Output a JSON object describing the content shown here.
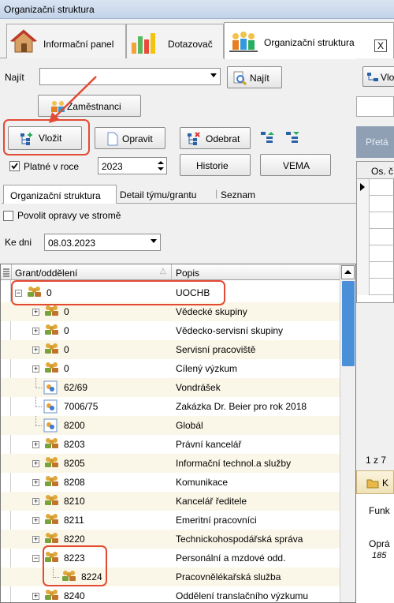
{
  "window": {
    "title": "Organizační struktura"
  },
  "tabs": [
    {
      "label": "Informační panel"
    },
    {
      "label": "Dotazovač"
    },
    {
      "label": "Organizační struktura"
    }
  ],
  "tab_close": "X",
  "search": {
    "label": "Najít",
    "value": "",
    "button": "Najít"
  },
  "buttons": {
    "employees": "Zaměstnanci",
    "insert": "Vložit",
    "edit": "Opravit",
    "remove": "Odebrat",
    "history": "Historie",
    "vema": "VEMA"
  },
  "valid_in_year": {
    "label": "Platné v roce",
    "checked": true,
    "value": "2023"
  },
  "subtabs": [
    "Organizační struktura",
    "Detail týmu/grantu",
    "Seznam"
  ],
  "allow_edit": {
    "label": "Povolit opravy ve stromě",
    "checked": false
  },
  "date": {
    "label": "Ke dni",
    "value": "08.03.2023"
  },
  "grid": {
    "col1": "Grant/oddělení",
    "col2": "Popis",
    "rows": [
      {
        "code": "0",
        "desc": "UOCHB",
        "icon": "group-icon",
        "expanded": true
      },
      {
        "code": "0",
        "desc": "Vědecké skupiny",
        "icon": "group-icon"
      },
      {
        "code": "0",
        "desc": "Vědecko-servisní skupiny",
        "icon": "group-icon"
      },
      {
        "code": "0",
        "desc": "Servisní pracoviště",
        "icon": "group-icon"
      },
      {
        "code": "0",
        "desc": "Cílený výzkum",
        "icon": "group-icon"
      },
      {
        "code": "62/69",
        "desc": "Vondrášek",
        "icon": "grant-icon"
      },
      {
        "code": "7006/75",
        "desc": "Zakázka Dr. Beier pro rok 2018",
        "icon": "grant-icon"
      },
      {
        "code": "8200",
        "desc": "Globál",
        "icon": "grant-icon"
      },
      {
        "code": "8203",
        "desc": "Právní kancelář",
        "icon": "group-icon"
      },
      {
        "code": "8205",
        "desc": "Informační technol.a služby",
        "icon": "group-icon"
      },
      {
        "code": "8208",
        "desc": "Komunikace",
        "icon": "group-icon"
      },
      {
        "code": "8210",
        "desc": "Kancelář ředitele",
        "icon": "group-icon"
      },
      {
        "code": "8211",
        "desc": "Emeritní pracovníci",
        "icon": "group-icon"
      },
      {
        "code": "8220",
        "desc": "Technickohospodářská správa",
        "icon": "group-icon"
      },
      {
        "code": "8223",
        "desc": "Personální a mzdové odd.",
        "icon": "group-icon",
        "expanded": true
      },
      {
        "code": "8224",
        "desc": "Pracovnělékařská služba",
        "icon": "group-icon"
      },
      {
        "code": "8240",
        "desc": "Oddělení translačního výzkumu",
        "icon": "group-icon"
      }
    ]
  },
  "right_panel": {
    "top_button": "Vlo",
    "header": "Přetá",
    "col": "Os. č",
    "pager": "1 z 7",
    "section": "K",
    "label1": "Funk",
    "label2": "Oprá",
    "value2": "185"
  },
  "accent": "#e34a33"
}
